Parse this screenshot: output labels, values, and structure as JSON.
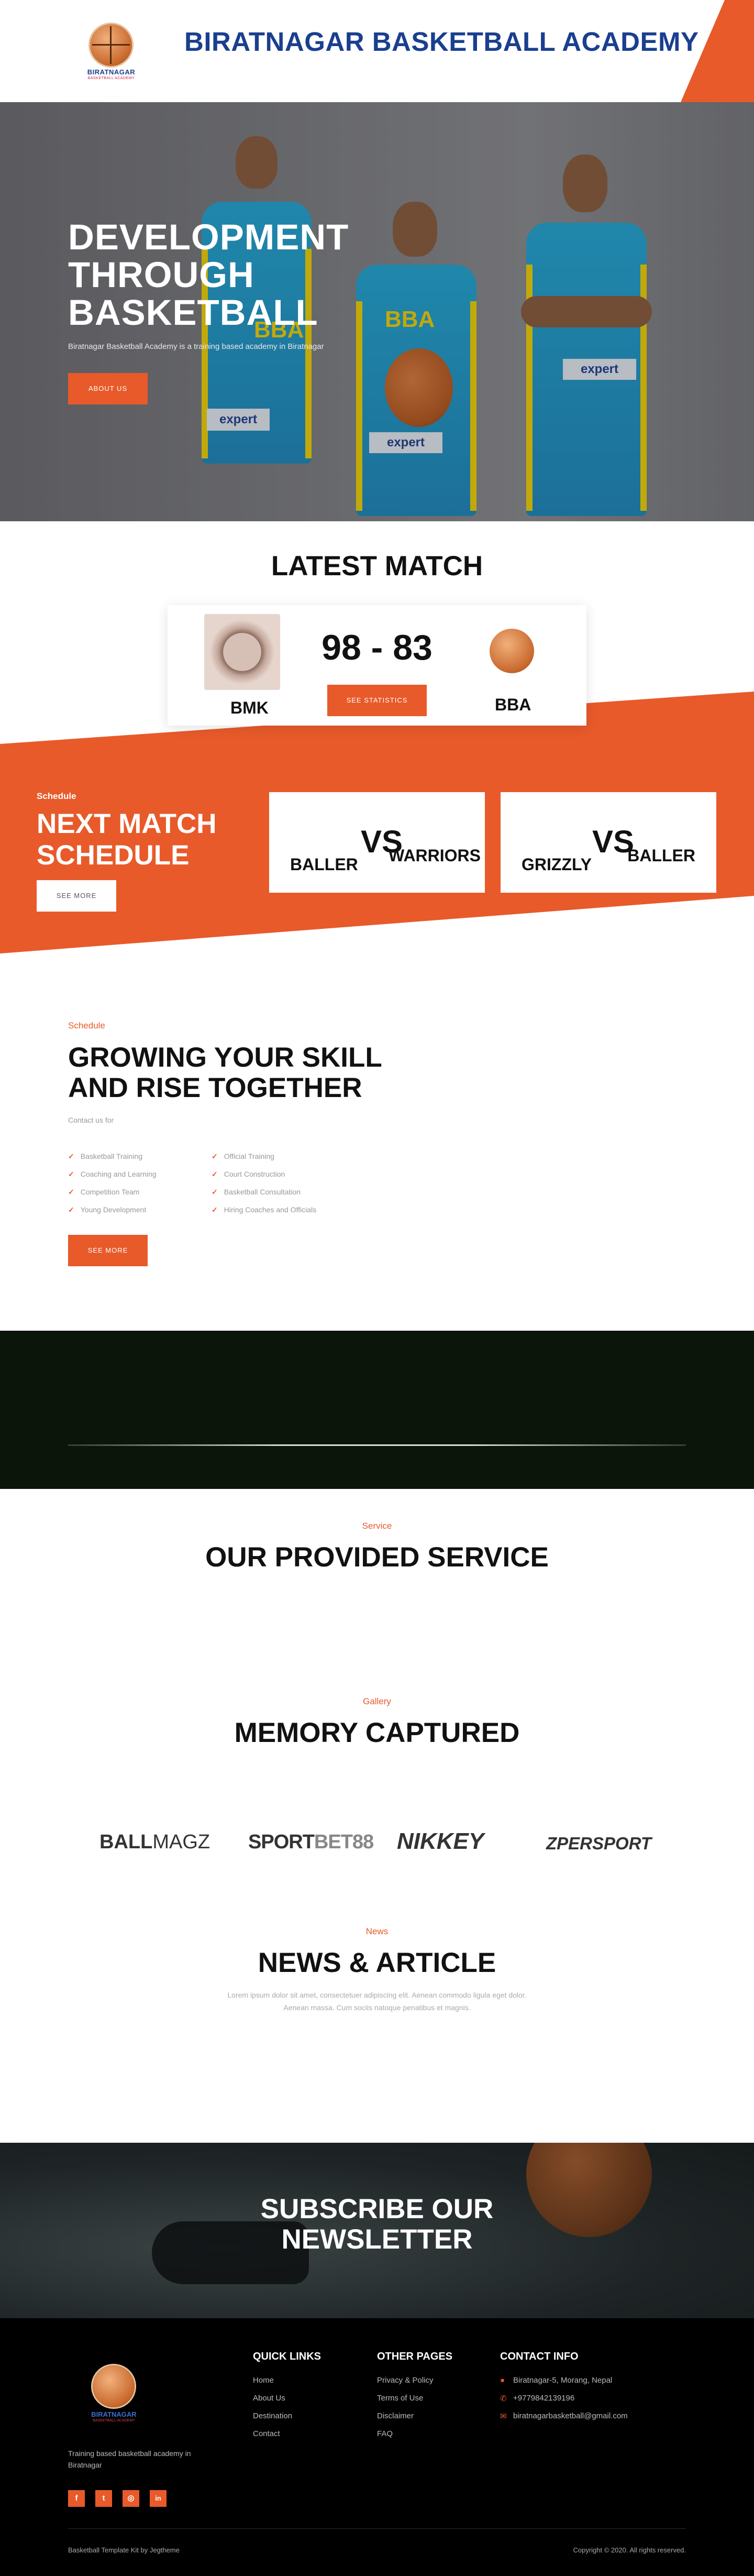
{
  "header": {
    "logo_text": "BIRATNAGAR",
    "logo_sub": "BASKETBALL ACADEMY",
    "site_title": "BIRATNAGAR BASKETBALL ACADEMY"
  },
  "hero": {
    "title_line1": "DEVELOPMENT",
    "title_line2": "THROUGH",
    "title_line3": "BASKETBALL",
    "subtitle": "Biratnagar Basketball Academy is a training based academy in Biratnagar",
    "button": "ABOUT US",
    "jersey_text": "BBA",
    "sponsor_text": "expert"
  },
  "latest_match": {
    "title": "LATEST MATCH",
    "home_team": "BMK",
    "away_team": "BBA",
    "score": "98 - 83",
    "button": "SEE STATISTICS"
  },
  "next_match": {
    "eyebrow": "Schedule",
    "title_line1": "NEXT MATCH",
    "title_line2": "SCHEDULE",
    "button": "SEE MORE",
    "vs_label": "VS",
    "matches": [
      {
        "team1": "BALLER",
        "team2": "WARRIORS"
      },
      {
        "team1": "GRIZZLY",
        "team2": "BALLER"
      }
    ]
  },
  "skill": {
    "eyebrow": "Schedule",
    "title_line1": "GROWING YOUR SKILL",
    "title_line2": "AND RISE TOGETHER",
    "small": "Contact us for",
    "list_left": [
      "Basketball Training",
      "Coaching and Learning",
      "Competition Team",
      "Young Development"
    ],
    "list_right": [
      "Official Training",
      "Court Construction",
      "Basketball Consultation",
      "Hiring Coaches and Officials"
    ],
    "button": "SEE MORE"
  },
  "service": {
    "eyebrow": "Service",
    "title": "OUR PROVIDED SERVICE"
  },
  "gallery": {
    "eyebrow": "Gallery",
    "title": "MEMORY CAPTURED"
  },
  "brands": {
    "b1a": "BALL",
    "b1b": "MAGZ",
    "b2a": "SPORT",
    "b2b": "BET88",
    "b3": "NIKKEY",
    "b4": "ZPERSPORT"
  },
  "news": {
    "eyebrow": "News",
    "title": "NEWS & ARTICLE",
    "desc": "Lorem ipsum dolor sit amet, consectetuer adipiscing elit. Aenean commodo ligula eget dolor. Aenean massa. Cum sociis natoque penatibus et magnis."
  },
  "subscribe": {
    "title_line1": "SUBSCRIBE OUR",
    "title_line2": "NEWSLETTER"
  },
  "footer": {
    "desc": "Training based basketball academy in Biratnagar",
    "social": [
      "f",
      "t",
      "◎",
      "in"
    ],
    "quick_links_title": "QUICK LINKS",
    "quick_links": [
      "Home",
      "About Us",
      "Destination",
      "Contact"
    ],
    "other_pages_title": "OTHER PAGES",
    "other_pages": [
      "Privacy & Policy",
      "Terms of Use",
      "Disclaimer",
      "FAQ"
    ],
    "contact_title": "CONTACT INFO",
    "address": "Biratnagar-5, Morang, Nepal",
    "phone": "+9779842139196",
    "email": "biratnagarbasketball@gmail.com",
    "bottom_left": "Basketball Template Kit by Jegtheme",
    "bottom_right": "Copyright © 2020. All rights reserved."
  },
  "colors": {
    "accent": "#e85a2a",
    "brand_blue": "#1a3f8f",
    "jersey": "#1ea7d6"
  },
  "icons": [
    "check-icon",
    "map-pin-icon",
    "phone-icon",
    "mail-icon",
    "facebook-icon",
    "twitter-icon",
    "instagram-icon",
    "linkedin-icon"
  ]
}
